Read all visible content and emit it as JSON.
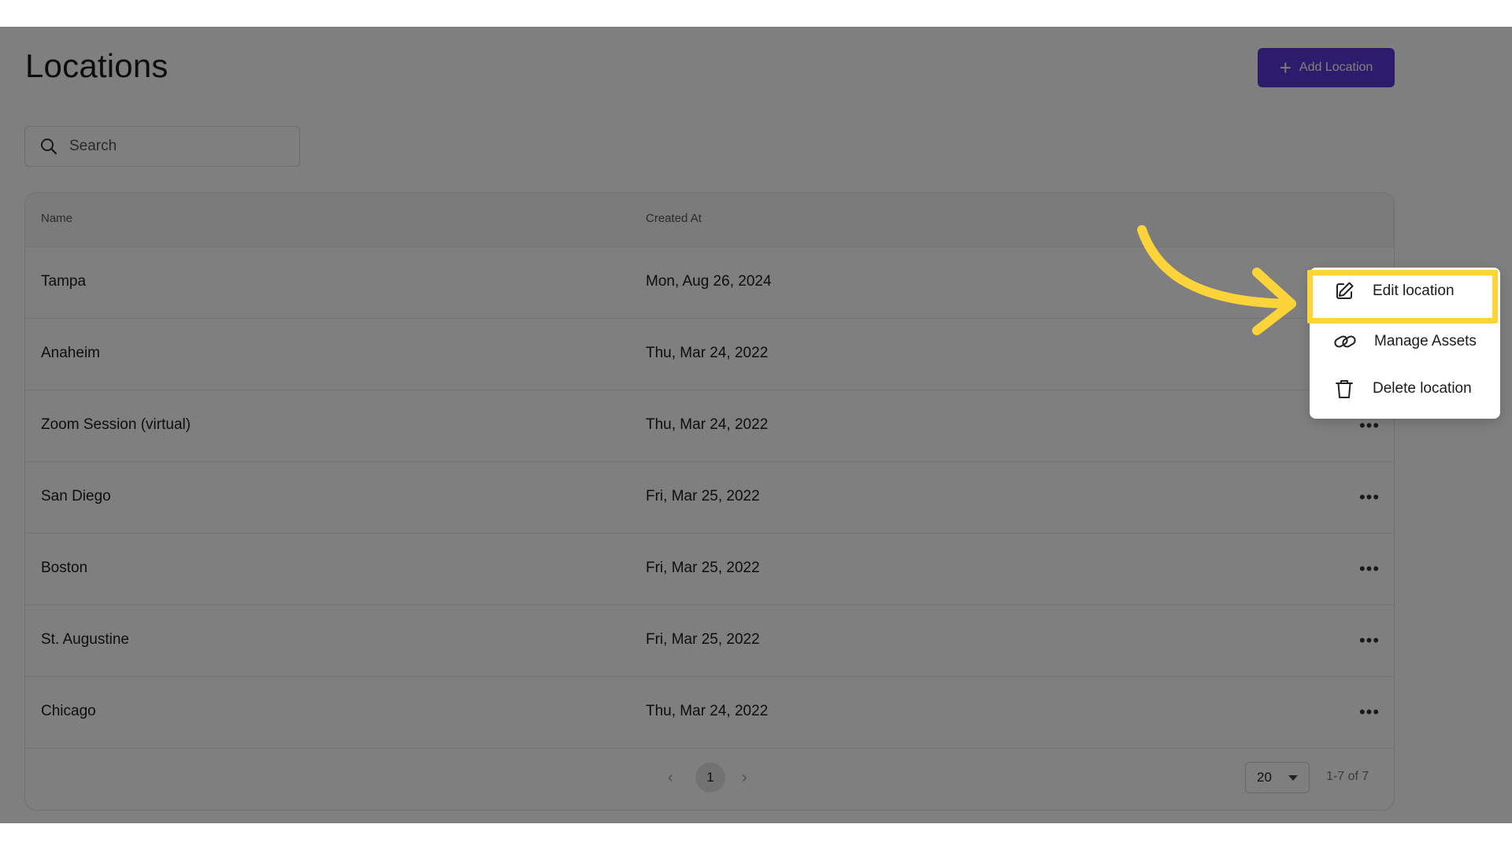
{
  "header": {
    "title": "Locations",
    "add_button_label": "Add Location"
  },
  "search": {
    "placeholder": "Search"
  },
  "table": {
    "columns": [
      "Name",
      "Created At"
    ],
    "rows": [
      {
        "name": "Tampa",
        "created": "Mon, Aug 26, 2024"
      },
      {
        "name": "Anaheim",
        "created": "Thu, Mar 24, 2022"
      },
      {
        "name": "Zoom Session (virtual)",
        "created": "Thu, Mar 24, 2022"
      },
      {
        "name": "San Diego",
        "created": "Fri, Mar 25, 2022"
      },
      {
        "name": "Boston",
        "created": "Fri, Mar 25, 2022"
      },
      {
        "name": "St. Augustine",
        "created": "Fri, Mar 25, 2022"
      },
      {
        "name": "Chicago",
        "created": "Thu, Mar 24, 2022"
      }
    ],
    "more_label": "•••"
  },
  "pagination": {
    "prev": "‹",
    "current_page": "1",
    "next": "›",
    "page_size": "20",
    "range": "1-7 of 7"
  },
  "context_menu": {
    "items": [
      {
        "label": "Edit location",
        "icon": "edit-icon"
      },
      {
        "label": "Manage Assets",
        "icon": "link-icon"
      },
      {
        "label": "Delete location",
        "icon": "trash-icon"
      }
    ]
  },
  "colors": {
    "accent": "#5b39d6",
    "highlight": "#ffd43b",
    "overlay": "rgba(0,0,0,0.5)"
  }
}
